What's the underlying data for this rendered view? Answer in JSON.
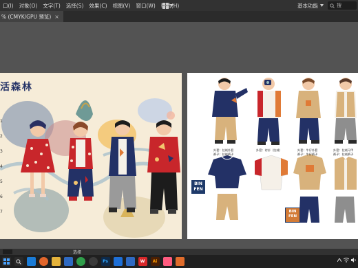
{
  "menubar": {
    "items": [
      "口(I)",
      "对象(O)",
      "文字(T)",
      "选择(S)",
      "效果(C)",
      "视图(V)",
      "窗口(W)",
      "帮助(H)"
    ],
    "workspace": "基本功能",
    "search_placeholder": "搜"
  },
  "document_tab": {
    "label": "% (CMYK/GPU 预览)",
    "close": "×"
  },
  "artboard_left": {
    "title": "活森林",
    "side_numbers": [
      "1",
      "2",
      "3",
      "4",
      "5",
      "6",
      "7"
    ]
  },
  "artboard_right": {
    "brand_logo": "BIN FEN",
    "brand_logo_small": "BIN FEN",
    "captions": [
      {
        "line1": "外套：拉绒外套",
        "line2": "裤子：拉绒裤子"
      },
      {
        "line1": "外套：衬衫（拉绒）",
        "line2": ""
      },
      {
        "line1": "外套：牛仔外套",
        "line2": "裤子：牛仔裤子"
      },
      {
        "line1": "外套：拉绒马甲",
        "line2": "裤子：拉绒裤子"
      }
    ]
  },
  "statusbar": {
    "tool_label": "选择"
  },
  "taskbar": {
    "apps": [
      {
        "name": "start",
        "label": "",
        "color": "#2a2a2a"
      },
      {
        "name": "search",
        "label": "",
        "color": "#2a2a2a"
      },
      {
        "name": "edge",
        "label": "",
        "color": "#1a7bd6"
      },
      {
        "name": "firefox",
        "label": "",
        "color": "#e2662b"
      },
      {
        "name": "explorer",
        "label": "",
        "color": "#e5b33b"
      },
      {
        "name": "files",
        "label": "",
        "color": "#2f6ac2"
      },
      {
        "name": "chrome",
        "label": "",
        "color": "#2f9e4a"
      },
      {
        "name": "obs",
        "label": "",
        "color": "#3a3a3a"
      },
      {
        "name": "photoshop",
        "label": "Ps",
        "color": "#0e2a4a"
      },
      {
        "name": "app-blue",
        "label": "",
        "color": "#1e6fd6"
      },
      {
        "name": "baidu",
        "label": "",
        "color": "#2f6ac2"
      },
      {
        "name": "wps",
        "label": "W",
        "color": "#d8282a"
      },
      {
        "name": "illustrator",
        "label": "Ai",
        "color": "#4a1f04"
      },
      {
        "name": "app-pink",
        "label": "",
        "color": "#ff5b7f"
      },
      {
        "name": "app-orange",
        "label": "",
        "color": "#e06c2b"
      }
    ]
  },
  "colors": {
    "navy": "#233166",
    "red": "#c8262b",
    "tan": "#d8b27c",
    "gray": "#8e8e8e"
  }
}
